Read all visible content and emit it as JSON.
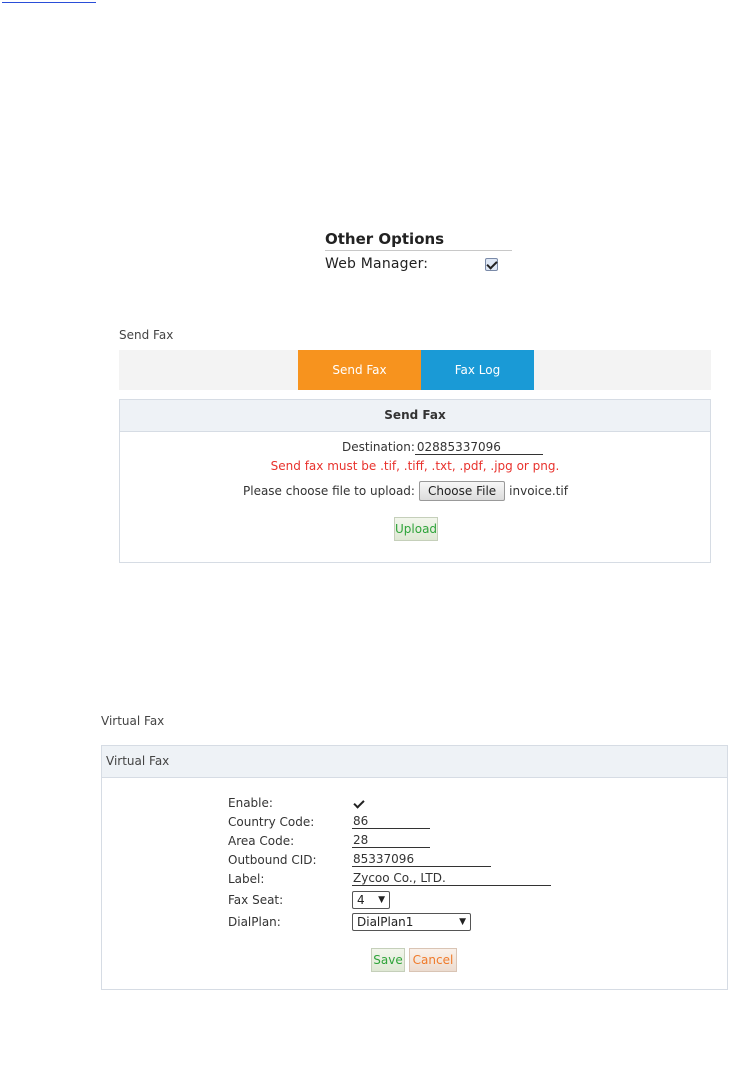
{
  "other_options": {
    "title": "Other Options",
    "web_manager_label": "Web Manager:",
    "web_manager_checked": true
  },
  "send_fax": {
    "section_title": "Send Fax",
    "tabs": [
      {
        "label": "Send Fax",
        "active": true,
        "color": "#f7931e"
      },
      {
        "label": "Fax Log",
        "active": false,
        "color": "#1a9ad6"
      }
    ],
    "panel_title": "Send Fax",
    "destination_label": "Destination:",
    "destination_value": "02885337096",
    "warning": "Send fax must be .tif, .tiff, .txt, .pdf, .jpg or png.",
    "warning_color": "#e8322d",
    "upload_label": "Please choose file to upload:",
    "choose_file_label": "Choose File",
    "file_name": "invoice.tif",
    "upload_button": "Upload"
  },
  "virtual_fax": {
    "section_title": "Virtual Fax",
    "panel_title": "Virtual Fax",
    "enable_label": "Enable:",
    "enable_checked": true,
    "country_code_label": "Country Code:",
    "country_code_value": "86",
    "area_code_label": "Area Code:",
    "area_code_value": "28",
    "outbound_cid_label": "Outbound CID:",
    "outbound_cid_value": "85337096",
    "label_label": "Label:",
    "label_value": "Zycoo Co., LTD.",
    "fax_seat_label": "Fax Seat:",
    "fax_seat_value": "4",
    "dialplan_label": "DialPlan:",
    "dialplan_value": "DialPlan1",
    "save_button": "Save",
    "cancel_button": "Cancel"
  }
}
